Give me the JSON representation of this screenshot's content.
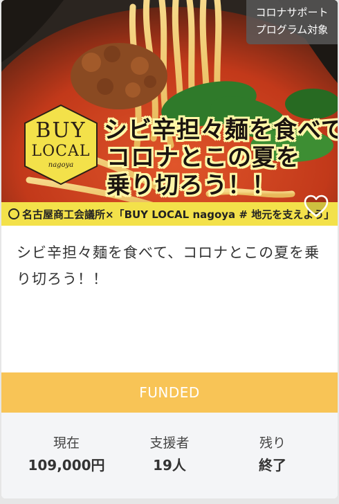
{
  "project": {
    "tag": [
      "コロナサポート",
      "プログラム対象"
    ],
    "hero": {
      "headline": [
        "シビ辛担々麺を食べて、",
        "コロナとこの夏を",
        "乗り切ろう！！"
      ],
      "logo": [
        "BUY",
        "LOCAL",
        "nagoya"
      ],
      "banner": "名古屋商工会議所×「BUY LOCAL nagoya # 地元を支えよう」"
    },
    "favorite_icon": "heart-outline-icon",
    "title": "シビ辛担々麺を食べて、コロナとこの夏を乗り切ろう！！",
    "status": "FUNDED",
    "stats": [
      {
        "label": "現在",
        "value": "109,000円"
      },
      {
        "label": "支援者",
        "value": "19人"
      },
      {
        "label": "残り",
        "value": "終了"
      }
    ]
  },
  "colors": {
    "status_bar": "#f8c456",
    "stats_bg": "#f4f5f7",
    "banner_yellow": "#f3e14a",
    "text": "#333333"
  }
}
